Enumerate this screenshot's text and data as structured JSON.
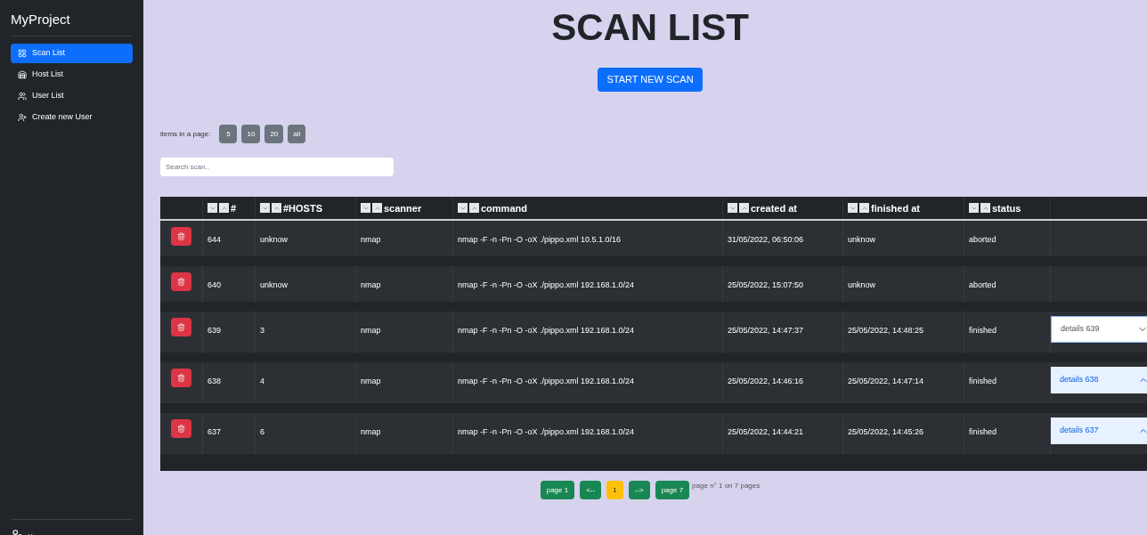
{
  "sidebar": {
    "brand": "MyProject",
    "items": [
      {
        "label": "Scan List",
        "selected": true
      },
      {
        "label": "Host List",
        "selected": false
      },
      {
        "label": "User List",
        "selected": false
      },
      {
        "label": "Create new User",
        "selected": false
      }
    ]
  },
  "title": "SCAN LIST",
  "start_button": "START NEW SCAN",
  "page_size": {
    "label": "items in a page:",
    "options": [
      "5",
      "10",
      "20",
      "all"
    ]
  },
  "search": {
    "placeholder": "Search scan.."
  },
  "table": {
    "columns": [
      "#",
      "#HOSTS",
      "scanner",
      "command",
      "created at",
      "finished at",
      "status"
    ],
    "rows": [
      {
        "cells": [
          "644",
          "unknow",
          "nmap",
          "nmap -F -n -Pn -O -oX ./pippo.xml 10.5.1.0/16",
          "31/05/2022, 06:50:06",
          "unknow",
          "aborted"
        ]
      },
      {
        "cells": [
          "640",
          "unknow",
          "nmap",
          "nmap -F -n -Pn -O -oX ./pippo.xml 192.168.1.0/24",
          "25/05/2022, 15:07:50",
          "unknow",
          "aborted"
        ]
      },
      {
        "cells": [
          "639",
          "3",
          "nmap",
          "nmap -F -n -Pn -O -oX ./pippo.xml 192.168.1.0/24",
          "25/05/2022, 14:47:37",
          "25/05/2022, 14:48:25",
          "finished"
        ],
        "details": {
          "label": "details 639",
          "expanded": false
        }
      },
      {
        "cells": [
          "638",
          "4",
          "nmap",
          "nmap -F -n -Pn -O -oX ./pippo.xml 192.168.1.0/24",
          "25/05/2022, 14:46:16",
          "25/05/2022, 14:47:14",
          "finished"
        ],
        "details": {
          "label": "details 638",
          "expanded": true
        }
      },
      {
        "cells": [
          "637",
          "6",
          "nmap",
          "nmap -F -n -Pn -O -oX ./pippo.xml 192.168.1.0/24",
          "25/05/2022, 14:44:21",
          "25/05/2022, 14:45:26",
          "finished"
        ],
        "details": {
          "label": "details 637",
          "expanded": true
        }
      }
    ]
  },
  "pagination": {
    "buttons": [
      {
        "label": "page 1",
        "selected": false
      },
      {
        "label": "<--",
        "selected": false
      },
      {
        "label": "1",
        "selected": true
      },
      {
        "label": "-->",
        "selected": false
      },
      {
        "label": "page 7",
        "selected": false
      }
    ],
    "info": "page n° 1 on 7 pages"
  }
}
